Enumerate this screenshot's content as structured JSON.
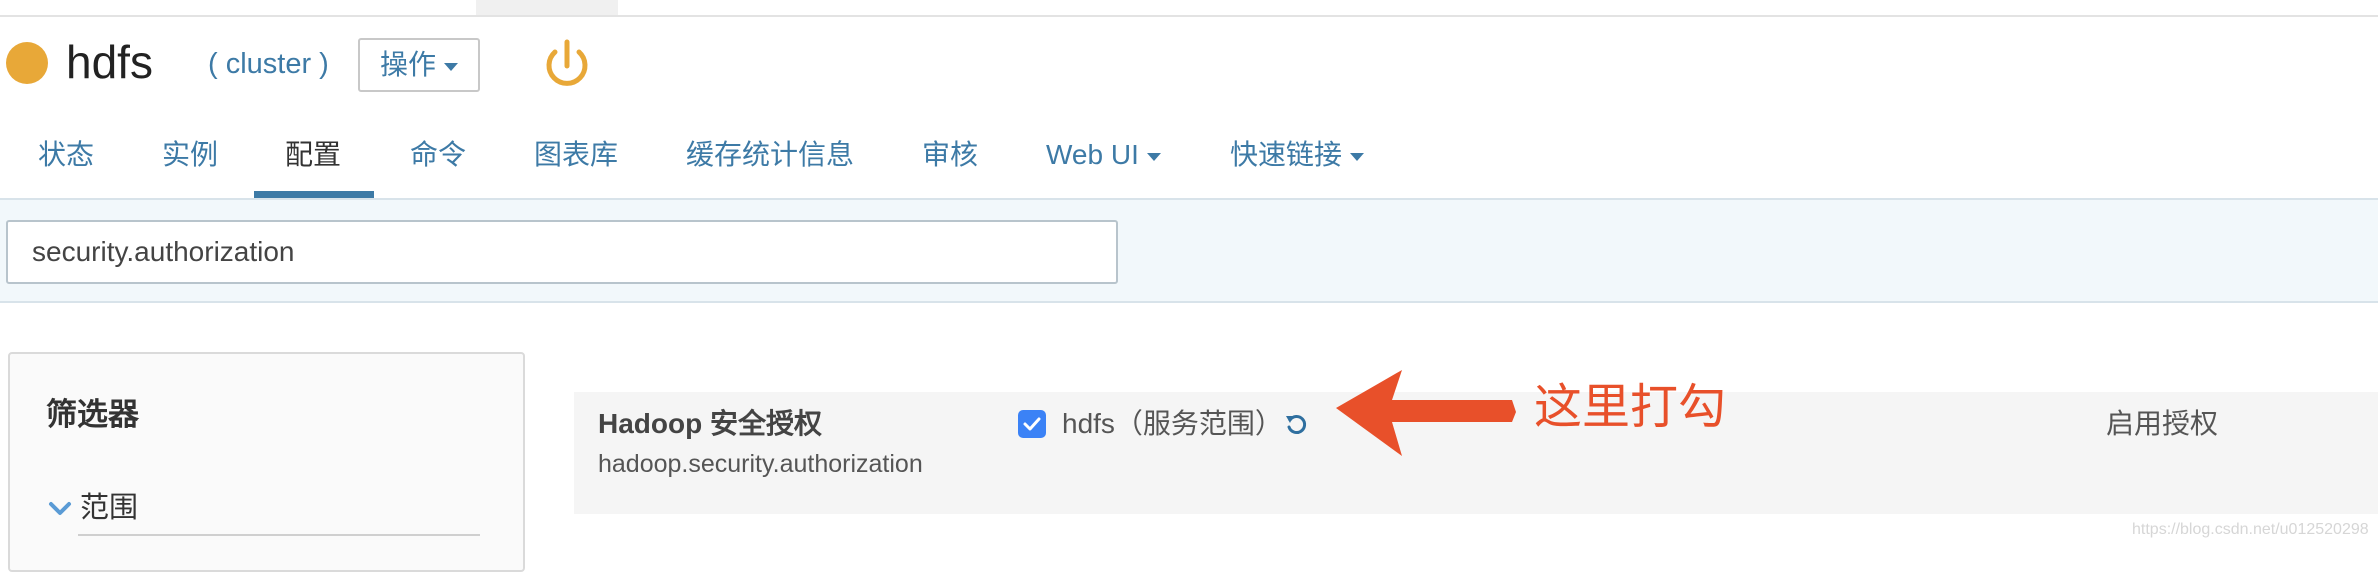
{
  "header": {
    "service_name": "hdfs",
    "cluster_label": "( cluster )",
    "actions_label": "操作",
    "status_color": "#e8a838",
    "power_icon": "power-icon"
  },
  "tabs": [
    {
      "label": "状态",
      "active": false
    },
    {
      "label": "实例",
      "active": false
    },
    {
      "label": "配置",
      "active": true
    },
    {
      "label": "命令",
      "active": false
    },
    {
      "label": "图表库",
      "active": false
    },
    {
      "label": "缓存统计信息",
      "active": false
    },
    {
      "label": "审核",
      "active": false
    },
    {
      "label": "Web UI",
      "active": false,
      "dropdown": true
    },
    {
      "label": "快速链接",
      "active": false,
      "dropdown": true
    }
  ],
  "search": {
    "value": "security.authorization"
  },
  "filter": {
    "title": "筛选器",
    "scope_label": "范围"
  },
  "config": {
    "display_name": "Hadoop 安全授权",
    "property_key": "hadoop.security.authorization",
    "checked": true,
    "scope_value": "hdfs（服务范围）",
    "description": "启用授权"
  },
  "annotation": {
    "text": "这里打勾",
    "color": "#e8502a"
  },
  "watermark": "https://blog.csdn.net/u012520298",
  "colors": {
    "accent": "#3d7aa6",
    "checkbox": "#3b82f6"
  }
}
